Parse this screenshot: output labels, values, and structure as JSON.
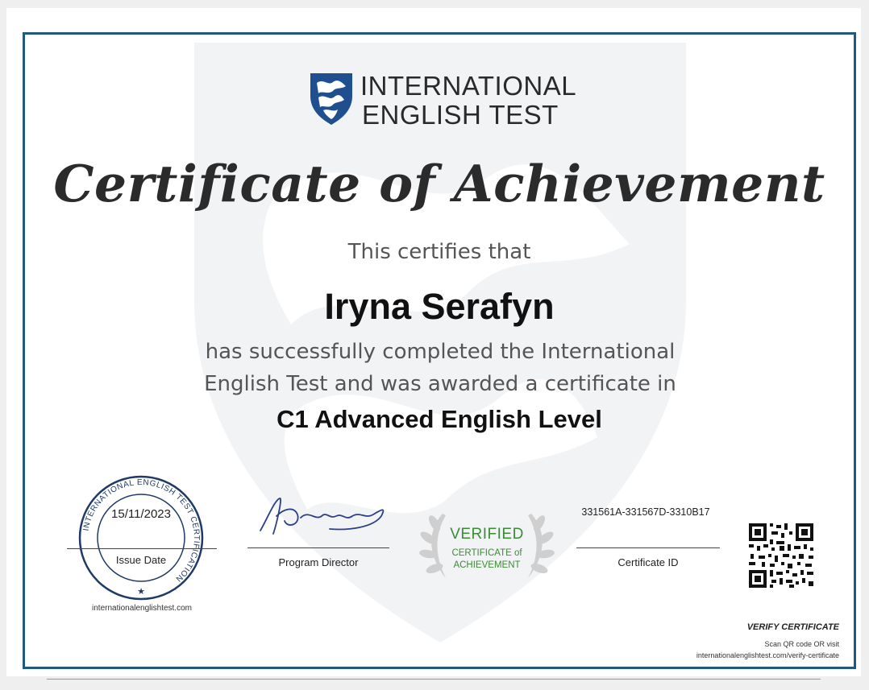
{
  "logo": {
    "line1": "INTERNATIONAL",
    "line2": "ENGLISH TEST"
  },
  "certificate": {
    "title": "Certificate of Achievement",
    "certifies": "This certifies that",
    "recipient": "Iryna Serafyn",
    "body_line1": "has successfully completed the International",
    "body_line2": "English Test and was awarded a certificate in",
    "level": "C1 Advanced English Level"
  },
  "seal": {
    "ring_text": "INTERNATIONAL ENGLISH TEST CERTIFICATION",
    "issue_date": "15/11/2023",
    "issue_date_label": "Issue Date",
    "website": "internationalenglishtest.com"
  },
  "signature": {
    "label": "Program Director"
  },
  "verified_badge": {
    "title": "VERIFIED",
    "line1": "CERTIFICATE of",
    "line2": "ACHIEVEMENT"
  },
  "certificate_id": {
    "value": "331561A-331567D-3310B17",
    "label": "Certificate ID"
  },
  "verify": {
    "title": "VERIFY CERTIFICATE",
    "line1": "Scan QR code OR visit",
    "line2": "internationalenglishtest.com/verify-certificate"
  },
  "colors": {
    "frame": "#1f5a7e",
    "verified_green": "#3c8b35",
    "shield_blue": "#1f4f8f"
  },
  "icons": {
    "logo": "shield-crest-icon",
    "badge": "laurel-wreath-icon",
    "qr": "qr-code-icon",
    "seal_star": "star-icon"
  }
}
